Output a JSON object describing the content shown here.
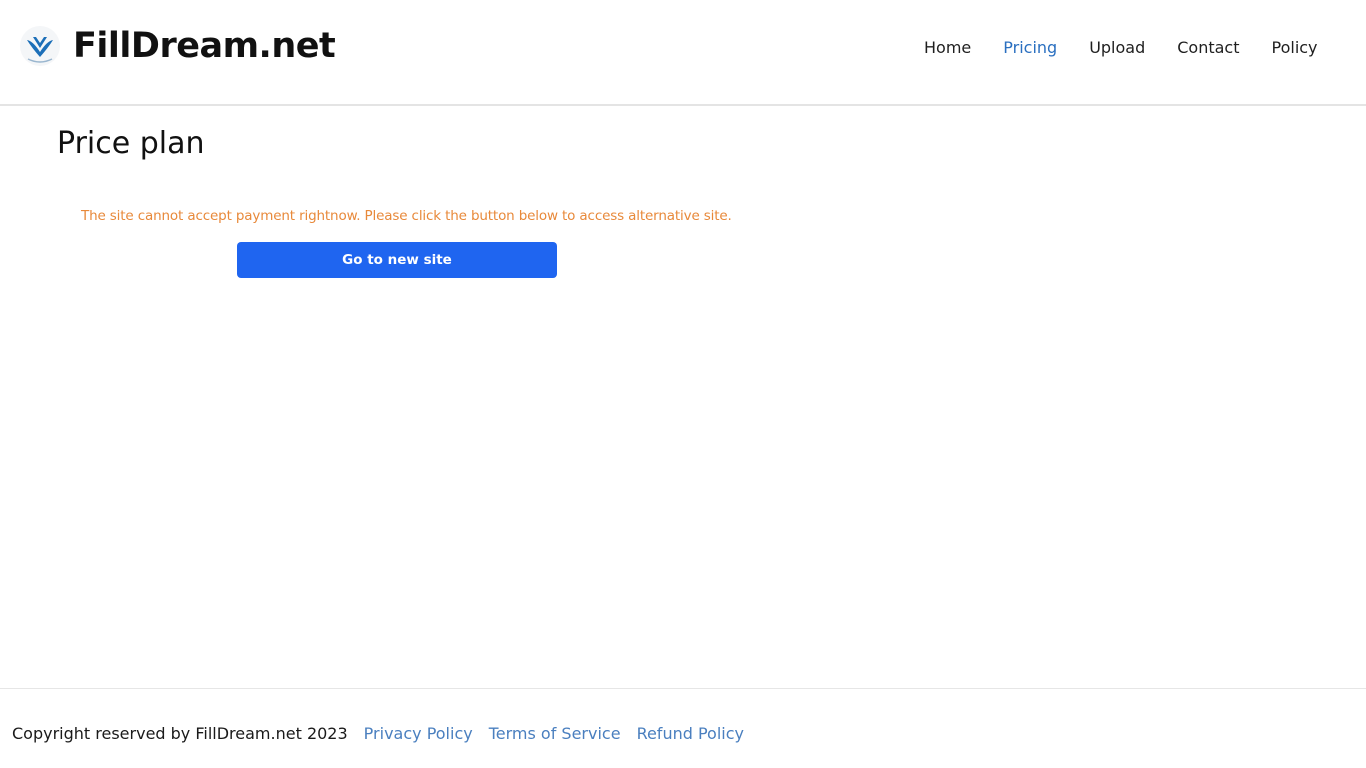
{
  "header": {
    "logo_text": "FillDream.net",
    "logo_icon": "filldream-logo-icon",
    "nav": [
      {
        "label": "Home",
        "active": false
      },
      {
        "label": "Pricing",
        "active": true
      },
      {
        "label": "Upload",
        "active": false
      },
      {
        "label": "Contact",
        "active": false
      },
      {
        "label": "Policy",
        "active": false
      }
    ]
  },
  "main": {
    "title": "Price plan",
    "notice": "The site cannot accept payment rightnow. Please click the button below to access alternative site.",
    "button_label": "Go to new site"
  },
  "footer": {
    "copyright": "Copyright reserved by FillDream.net 2023",
    "links": [
      {
        "label": "Privacy Policy"
      },
      {
        "label": "Terms of Service"
      },
      {
        "label": "Refund Policy"
      }
    ]
  },
  "colors": {
    "accent": "#1f65f0",
    "nav_active": "#2a6fc0",
    "notice": "#e8893a",
    "footer_link": "#4a7fbf",
    "logo_blue": "#1c6fb8"
  }
}
